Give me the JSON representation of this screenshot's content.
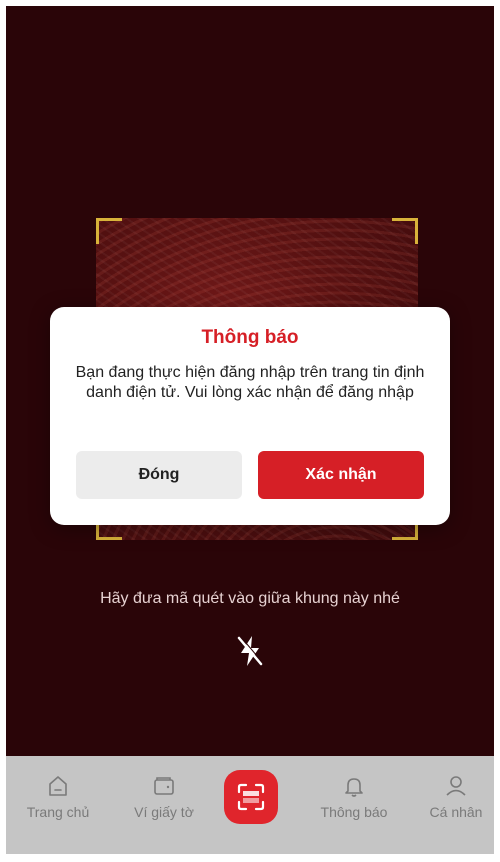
{
  "scanner": {
    "hint": "Hãy đưa mã quét vào giữa khung này nhé"
  },
  "dialog": {
    "title": "Thông báo",
    "message": "Bạn đang thực hiện đăng nhập trên trang tin định danh điện tử. Vui lòng xác nhận để đăng nhập",
    "close_label": "Đóng",
    "confirm_label": "Xác nhận"
  },
  "tabbar": {
    "items": [
      {
        "label": "Trang chủ",
        "icon": "home-icon"
      },
      {
        "label": "Ví giấy tờ",
        "icon": "wallet-icon"
      },
      {
        "label": "",
        "icon": "scan-icon"
      },
      {
        "label": "Thông báo",
        "icon": "bell-icon"
      },
      {
        "label": "Cá nhân",
        "icon": "person-icon"
      }
    ]
  },
  "colors": {
    "accent": "#d61f26",
    "frame": "#d8b33a",
    "background": "#2a0508",
    "tabbar": "#c5c5c5"
  }
}
